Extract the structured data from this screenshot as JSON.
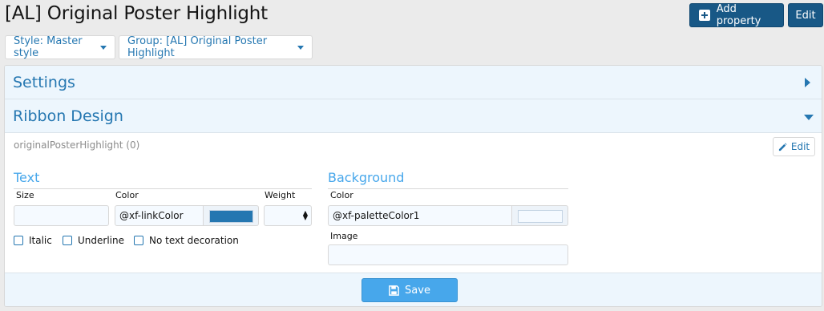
{
  "header": {
    "title": "[AL] Original Poster Highlight",
    "add_property_label": "Add property",
    "edit_label": "Edit"
  },
  "filters": {
    "style_label": "Style: Master style",
    "group_label": "Group: [AL] Original Poster Highlight"
  },
  "sections": {
    "settings_title": "Settings",
    "ribbon_title": "Ribbon Design"
  },
  "property": {
    "name": "originalPosterHighlight (0)",
    "edit_label": "Edit"
  },
  "text_group": {
    "title": "Text",
    "size_label": "Size",
    "size_value": "",
    "color_label": "Color",
    "color_value": "@xf-linkColor",
    "color_swatch": "#2577b1",
    "weight_label": "Weight",
    "weight_value": "",
    "checkboxes": {
      "italic": "Italic",
      "underline": "Underline",
      "no_decoration": "No text decoration"
    }
  },
  "background_group": {
    "title": "Background",
    "color_label": "Color",
    "color_value": "@xf-paletteColor1",
    "color_swatch": "#f5faff",
    "image_label": "Image",
    "image_value": ""
  },
  "footer": {
    "save_label": "Save"
  }
}
